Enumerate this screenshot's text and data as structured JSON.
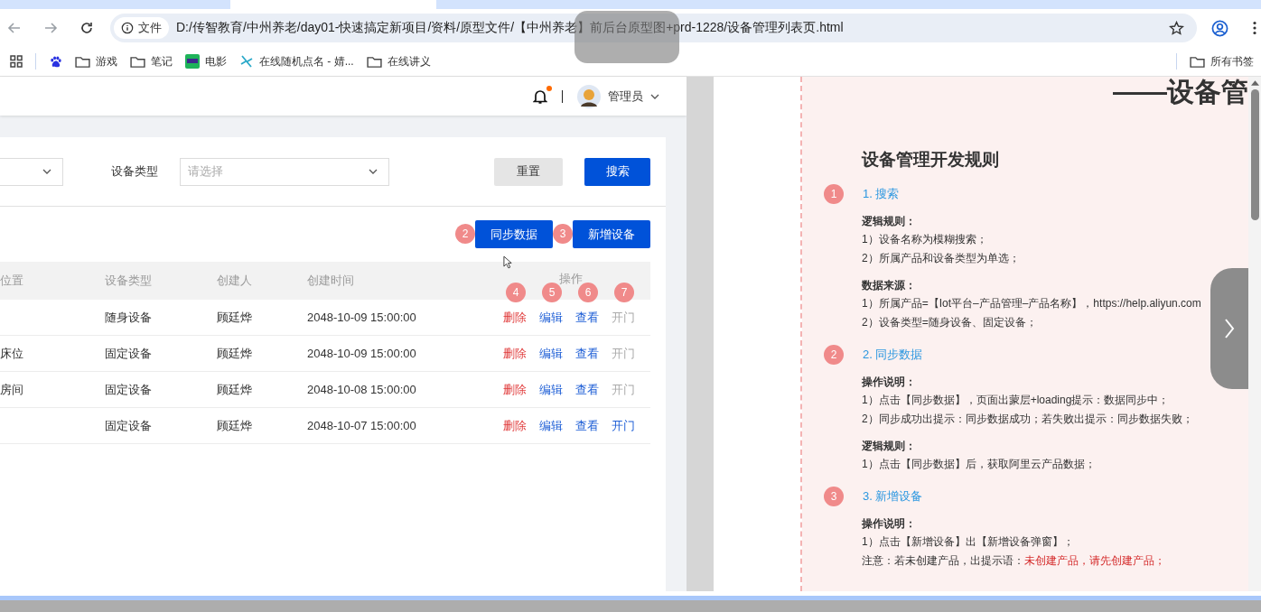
{
  "browser": {
    "security_label": "文件",
    "url": "D:/传智教育/中州养老/day01-快速搞定新项目/资料/原型文件/【中州养老】前后台原型图+prd-1228/设备管理列表页.html",
    "bookmarks": [
      {
        "label": "游戏",
        "kind": "folder"
      },
      {
        "label": "笔记",
        "kind": "folder"
      },
      {
        "label": "电影",
        "kind": "video"
      },
      {
        "label": "在线随机点名 - 婧...",
        "kind": "tool"
      },
      {
        "label": "在线讲义",
        "kind": "folder"
      }
    ],
    "all_bookmarks": "所有书签"
  },
  "app_header": {
    "unread": true,
    "user": "管理员"
  },
  "filters": [
    {
      "kind": "cut-select"
    },
    {
      "kind": "select",
      "label": "设备类型",
      "placeholder": "请选择"
    }
  ],
  "filter_buttons": [
    {
      "label": "重置",
      "kind": "secondary"
    },
    {
      "label": "搜索",
      "kind": "primary"
    }
  ],
  "toolbar": [
    {
      "label": "同步数据",
      "marker": "2"
    },
    {
      "label": "新增设备",
      "marker": "3"
    }
  ],
  "table": {
    "columns": [
      "位置",
      "设备类型",
      "创建人",
      "创建时间",
      "操作"
    ],
    "action_markers": [
      "4",
      "5",
      "6",
      "7"
    ],
    "rows": [
      {
        "position": "",
        "type": "随身设备",
        "creator": "顾廷烨",
        "time": "2048-10-09 15:00:00",
        "actions": [
          {
            "label": "删除",
            "kind": "danger",
            "disabled": false
          },
          {
            "label": "编辑",
            "kind": "link",
            "disabled": false
          },
          {
            "label": "查看",
            "kind": "link",
            "disabled": false
          },
          {
            "label": "开门",
            "kind": "link",
            "disabled": true
          }
        ]
      },
      {
        "position": "床位",
        "type": "固定设备",
        "creator": "顾廷烨",
        "time": "2048-10-09 15:00:00",
        "actions": [
          {
            "label": "删除",
            "kind": "danger",
            "disabled": false
          },
          {
            "label": "编辑",
            "kind": "link",
            "disabled": false
          },
          {
            "label": "查看",
            "kind": "link",
            "disabled": false
          },
          {
            "label": "开门",
            "kind": "link",
            "disabled": true
          }
        ]
      },
      {
        "position": "房间",
        "type": "固定设备",
        "creator": "顾廷烨",
        "time": "2048-10-08 15:00:00",
        "actions": [
          {
            "label": "删除",
            "kind": "danger",
            "disabled": false
          },
          {
            "label": "编辑",
            "kind": "link",
            "disabled": false
          },
          {
            "label": "查看",
            "kind": "link",
            "disabled": false
          },
          {
            "label": "开门",
            "kind": "link",
            "disabled": true
          }
        ]
      },
      {
        "position": "",
        "type": "固定设备",
        "creator": "顾廷烨",
        "time": "2048-10-07 15:00:00",
        "actions": [
          {
            "label": "删除",
            "kind": "danger",
            "disabled": false
          },
          {
            "label": "编辑",
            "kind": "link",
            "disabled": false
          },
          {
            "label": "查看",
            "kind": "link",
            "disabled": false
          },
          {
            "label": "开门",
            "kind": "link",
            "disabled": false
          }
        ]
      }
    ]
  },
  "doc": {
    "page_title": "——设备管",
    "heading": "设备管理开发规则",
    "sections": [
      {
        "marker": "1",
        "title": "1. 搜索",
        "blocks": [
          {
            "heading": "逻辑规则：",
            "lines": [
              {
                "text": "1）设备名称为模糊搜索；"
              },
              {
                "text": "2）所属产品和设备类型为单选；"
              }
            ]
          },
          {
            "heading": "数据来源：",
            "lines": [
              {
                "text": "1）所属产品=【Iot平台–产品管理–产品名称】，https://help.aliyun.com"
              },
              {
                "text": "2）设备类型=随身设备、固定设备；"
              }
            ]
          }
        ]
      },
      {
        "marker": "2",
        "title": "2. 同步数据",
        "blocks": [
          {
            "heading": "操作说明：",
            "lines": [
              {
                "text": "1）点击【同步数据】，页面出蒙层+loading提示：数据同步中；"
              },
              {
                "text": "2）同步成功出提示：同步数据成功；若失败出提示：同步数据失败；"
              }
            ]
          },
          {
            "heading": "逻辑规则：",
            "lines": [
              {
                "text": "1）点击【同步数据】后，获取阿里云产品数据；"
              }
            ]
          }
        ]
      },
      {
        "marker": "3",
        "title": "3. 新增设备",
        "blocks": [
          {
            "heading": "操作说明：",
            "lines": [
              {
                "text": "1）点击【新增设备】出【新增设备弹窗】；"
              },
              {
                "text": "注意：若未创建产品，出提示语：",
                "alert": "未创建产品，请先创建产品；"
              }
            ]
          }
        ]
      }
    ]
  }
}
